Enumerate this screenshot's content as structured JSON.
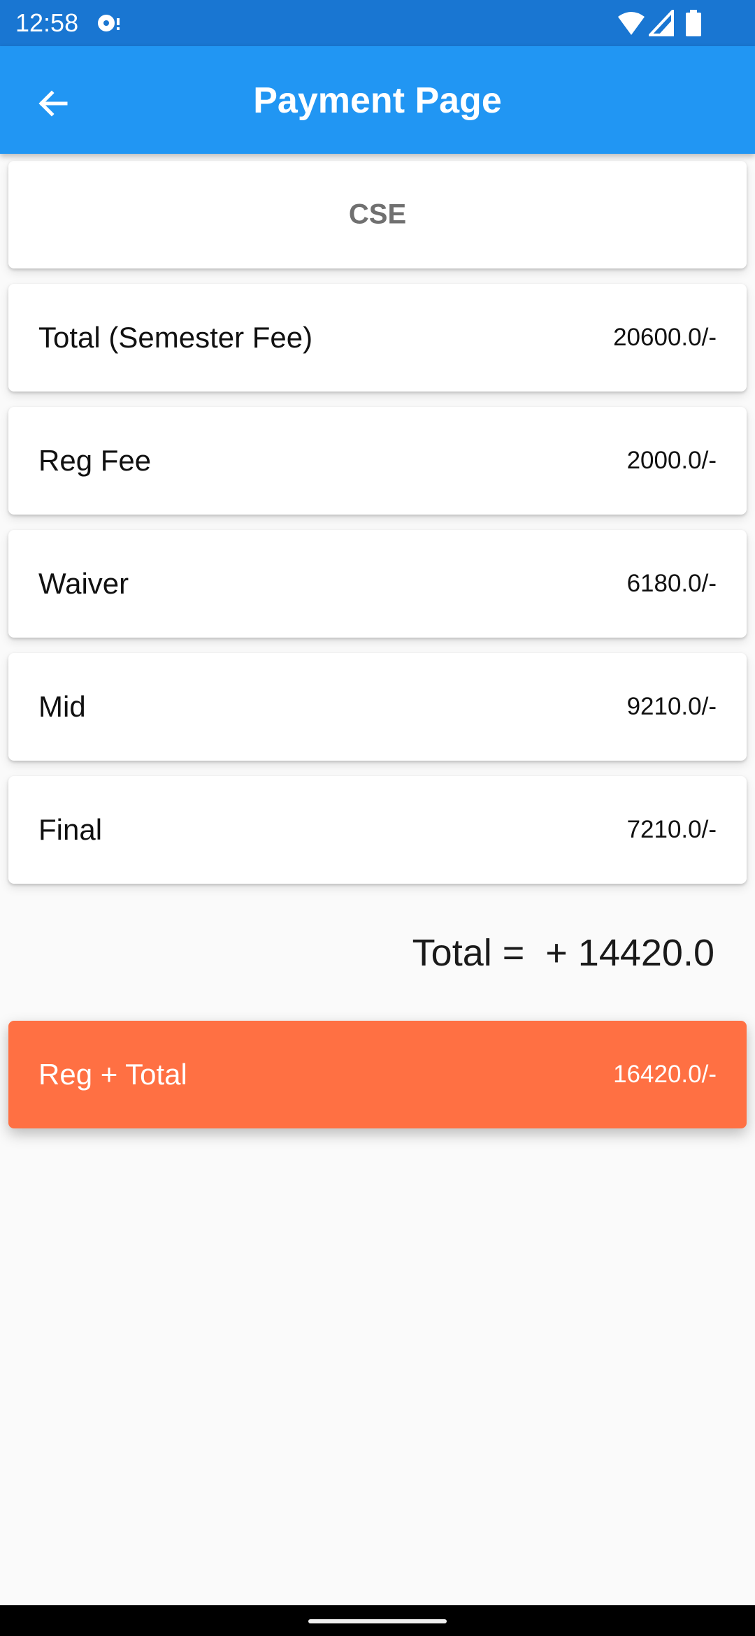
{
  "status_bar": {
    "time": "12:58"
  },
  "app_bar": {
    "title": "Payment Page"
  },
  "department": "CSE",
  "fees": [
    {
      "label": "Total (Semester Fee)",
      "value": "20600.0/-"
    },
    {
      "label": "Reg Fee",
      "value": "2000.0/-"
    },
    {
      "label": "Waiver",
      "value": "6180.0/-"
    },
    {
      "label": "Mid",
      "value": "9210.0/-"
    },
    {
      "label": "Final",
      "value": "7210.0/-"
    }
  ],
  "total_line": "Total =  + 14420.0",
  "reg_total": {
    "label": "Reg + Total",
    "value": "16420.0/-"
  },
  "colors": {
    "status_bar": "#1976d2",
    "app_bar": "#2196f3",
    "accent_card": "#ff7043",
    "background": "#fafafa"
  }
}
